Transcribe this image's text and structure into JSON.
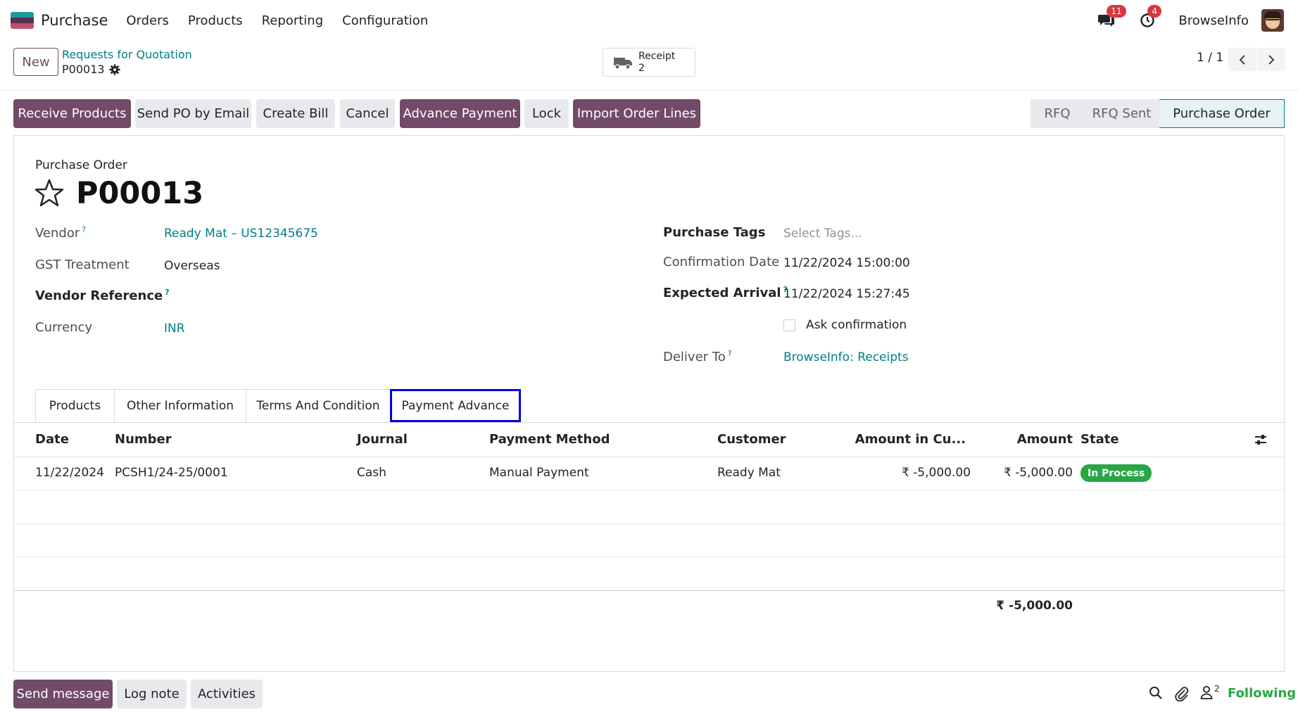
{
  "navbar": {
    "app_name": "Purchase",
    "menu": [
      "Orders",
      "Products",
      "Reporting",
      "Configuration"
    ],
    "messages_count": "11",
    "activities_count": "4",
    "company": "BrowseInfo"
  },
  "control_panel": {
    "new_label": "New",
    "breadcrumb": "Requests for Quotation",
    "record": "P00013",
    "receipt_label": "Receipt",
    "receipt_count": "2",
    "pager": "1 / 1"
  },
  "actions": {
    "receive_products": "Receive Products",
    "send_po_email": "Send PO by Email",
    "create_bill": "Create Bill",
    "cancel": "Cancel",
    "advance_payment": "Advance Payment",
    "lock": "Lock",
    "import_order_lines": "Import Order Lines"
  },
  "status": [
    "RFQ",
    "RFQ Sent",
    "Purchase Order"
  ],
  "form": {
    "subtitle": "Purchase Order",
    "title": "P00013",
    "vendor_label": "Vendor",
    "vendor_value": "Ready Mat – US12345675",
    "gst_label": "GST Treatment",
    "gst_value": "Overseas",
    "vendor_ref_label": "Vendor Reference",
    "currency_label": "Currency",
    "currency_value": "INR",
    "tags_label": "Purchase Tags",
    "tags_placeholder": "Select Tags...",
    "confirmation_label": "Confirmation Date",
    "confirmation_value": "11/22/2024 15:00:00",
    "expected_label": "Expected Arrival",
    "expected_value": "11/22/2024 15:27:45",
    "ask_confirmation": "Ask confirmation",
    "deliver_label": "Deliver To",
    "deliver_value": "BrowseInfo: Receipts",
    "help_mark": "?"
  },
  "tabs": [
    "Products",
    "Other Information",
    "Terms And Condition",
    "Payment Advance"
  ],
  "table": {
    "headers": [
      "Date",
      "Number",
      "Journal",
      "Payment Method",
      "Customer",
      "Amount in Cu...",
      "Amount",
      "State"
    ],
    "rows": [
      {
        "date": "11/22/2024",
        "number": "PCSH1/24-25/0001",
        "journal": "Cash",
        "method": "Manual Payment",
        "customer": "Ready Mat",
        "amount_currency": "₹ -5,000.00",
        "amount": "₹ -5,000.00",
        "state": "In Process"
      }
    ],
    "total": "₹ -5,000.00"
  },
  "chatter": {
    "send_message": "Send message",
    "log_note": "Log note",
    "activities": "Activities",
    "followers_count": "2",
    "following": "Following"
  },
  "colors": {
    "primary": "#714b67",
    "link": "#017e84",
    "success": "#28a745",
    "badge": "#d9363e",
    "tab_highlight": "#0000e0"
  }
}
